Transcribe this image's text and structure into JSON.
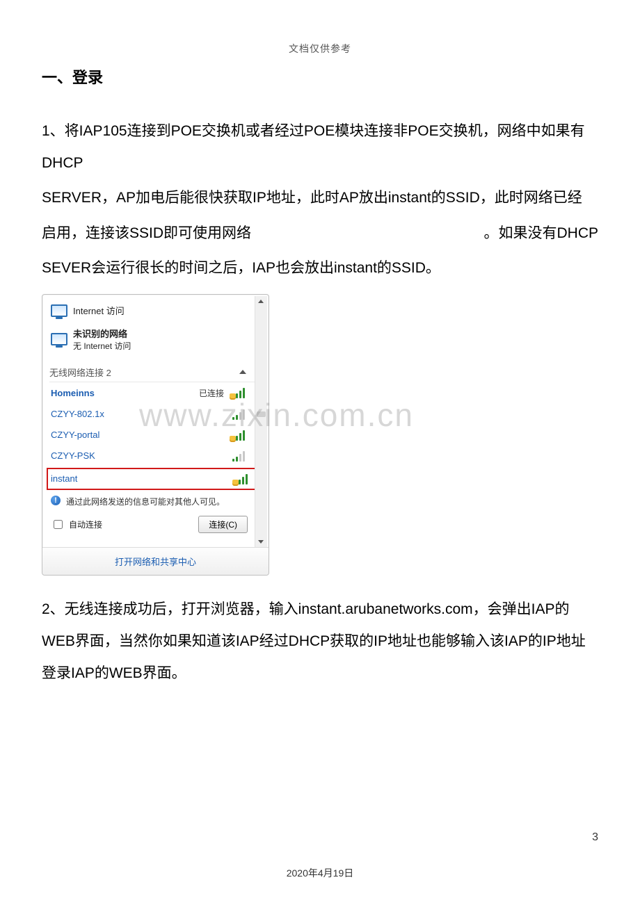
{
  "header_ref": "文档仅供参考",
  "h1": "一、登录",
  "para1": "1、将IAP105连接到POE交换机或者经过POE模块连接非POE交换机，网络中如果有DHCP",
  "para2": "SERVER，AP加电后能很快获取IP地址，此时AP放出instant的SSID，此时网络已经",
  "para3a": "启用，连接该SSID即可使用网络",
  "para3b": "。如果没有DHCP",
  "para4": "SEVER会运行很长的时间之后，IAP也会放出instant的SSID。",
  "panel": {
    "net1": {
      "title": "Internet 访问"
    },
    "net2": {
      "title": "未识别的网络",
      "sub": "无 Internet 访问"
    },
    "section": "无线网络连接 2",
    "items": [
      {
        "name": "Homeinns",
        "status": "已连接"
      },
      {
        "name": "CZYY-802.1x"
      },
      {
        "name": "CZYY-portal"
      },
      {
        "name": "CZYY-PSK"
      },
      {
        "name": "instant"
      }
    ],
    "info": "通过此网络发送的信息可能对其他人可见。",
    "auto": "自动连接",
    "connect": "连接(C)",
    "footer": "打开网络和共享中心"
  },
  "para5": "2、无线连接成功后，打开浏览器，输入instant.arubanetworks.com，会弹出IAP的WEB界面，当然你如果知道该IAP经过DHCP获取的IP地址也能够输入该IAP的IP地址登录IAP的WEB界面。",
  "watermark": "www.zixin.com.cn",
  "footer_date": "2020年4月19日",
  "page_num": "3"
}
